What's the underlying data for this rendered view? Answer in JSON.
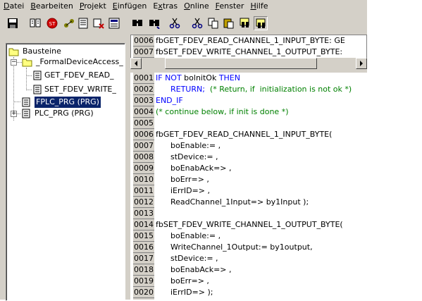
{
  "menu": [
    "Datei",
    "Bearbeiten",
    "Projekt",
    "Einfügen",
    "Extras",
    "Online",
    "Fenster",
    "Hilfe"
  ],
  "menu_underline": [
    "D",
    "B",
    "P",
    "E",
    "x",
    "O",
    "F",
    "H"
  ],
  "toolbar_icons": [
    "save-icon",
    "build-icon",
    "stop-icon",
    "link-icon",
    "object-icon",
    "delete-object-icon",
    "properties-icon",
    "find-icon",
    "find-next-icon",
    "cut-icon",
    "cut2-icon",
    "copy-icon",
    "paste-icon",
    "find-replace-icon",
    "find-replace2-icon"
  ],
  "tree": {
    "root": "Bausteine",
    "folder": "_FormalDeviceAccess_",
    "items": [
      "GET_FDEV_READ_",
      "SET_FDEV_WRITE_",
      "FPLC_PRG (PRG)",
      "PLC_PRG (PRG)"
    ]
  },
  "declaration_lines": [
    {
      "num": "0006",
      "text": "fbGET_FDEV_READ_CHANNEL_1_INPUT_BYTE: GE"
    },
    {
      "num": "0007",
      "text": "fbSET_FDEV_WRITE_CHANNEL_1_OUTPUT_BYTE:"
    }
  ],
  "code_lines": [
    {
      "num": "0001",
      "parts": [
        {
          "t": "IF NOT ",
          "c": "kw"
        },
        {
          "t": "bolnitOk ",
          "c": ""
        },
        {
          "t": "THEN",
          "c": "kw"
        }
      ]
    },
    {
      "num": "0002",
      "parts": [
        {
          "t": "      RETURN;  ",
          "c": "kw"
        },
        {
          "t": "(* Return, if  initialization is not ok *)",
          "c": "cm"
        }
      ]
    },
    {
      "num": "0003",
      "parts": [
        {
          "t": "END_IF",
          "c": "kw"
        }
      ]
    },
    {
      "num": "0004",
      "parts": [
        {
          "t": "(* continue below, if init is done *)",
          "c": "cm"
        }
      ]
    },
    {
      "num": "0005",
      "parts": []
    },
    {
      "num": "0006",
      "parts": [
        {
          "t": "fbGET_FDEV_READ_CHANNEL_1_INPUT_BYTE(",
          "c": ""
        }
      ]
    },
    {
      "num": "0007",
      "parts": [
        {
          "t": "      boEnable:= ,",
          "c": ""
        }
      ]
    },
    {
      "num": "0008",
      "parts": [
        {
          "t": "      stDevice:= ,",
          "c": ""
        }
      ]
    },
    {
      "num": "0009",
      "parts": [
        {
          "t": "      boEnabAck=> ,",
          "c": ""
        }
      ]
    },
    {
      "num": "0010",
      "parts": [
        {
          "t": "      boErr=> ,",
          "c": ""
        }
      ]
    },
    {
      "num": "0011",
      "parts": [
        {
          "t": "      iErrID=> ,",
          "c": ""
        }
      ]
    },
    {
      "num": "0012",
      "parts": [
        {
          "t": "      ReadChannel_1Input=> by1Input );",
          "c": ""
        }
      ]
    },
    {
      "num": "0013",
      "parts": []
    },
    {
      "num": "0014",
      "parts": [
        {
          "t": "fbSET_FDEV_WRITE_CHANNEL_1_OUTPUT_BYTE(",
          "c": ""
        }
      ]
    },
    {
      "num": "0015",
      "parts": [
        {
          "t": "      boEnable:= ,",
          "c": ""
        }
      ]
    },
    {
      "num": "0016",
      "parts": [
        {
          "t": "      WriteChannel_1Output:= by1output,",
          "c": ""
        }
      ]
    },
    {
      "num": "0017",
      "parts": [
        {
          "t": "      stDevice:= ,",
          "c": ""
        }
      ]
    },
    {
      "num": "0018",
      "parts": [
        {
          "t": "      boEnabAck=> ,",
          "c": ""
        }
      ]
    },
    {
      "num": "0019",
      "parts": [
        {
          "t": "      boErr=> ,",
          "c": ""
        }
      ]
    },
    {
      "num": "0020",
      "parts": [
        {
          "t": "      iErrID=> );",
          "c": ""
        }
      ]
    }
  ]
}
